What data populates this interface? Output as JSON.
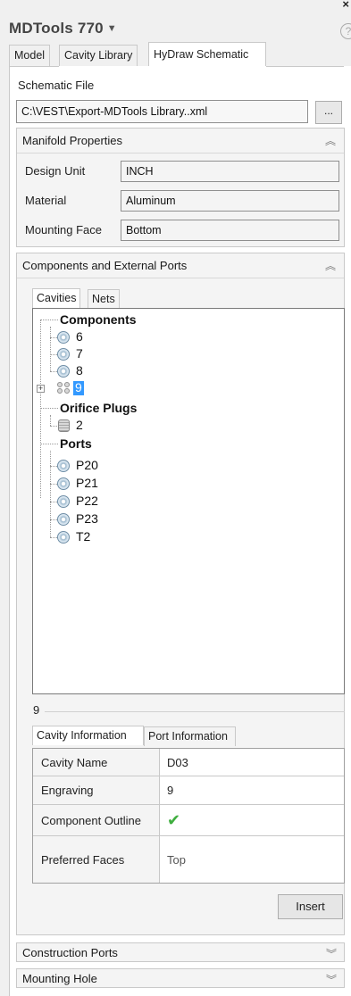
{
  "window": {
    "title": "MDTools 770",
    "close_glyph": "×",
    "help_glyph": "?"
  },
  "top_tabs": [
    {
      "label": "Model"
    },
    {
      "label": "Cavity Library"
    },
    {
      "label": "HyDraw Schematic",
      "active": true
    }
  ],
  "schematic": {
    "label": "Schematic File",
    "path": "C:\\VEST\\Export-MDTools Library..xml",
    "browse_label": "..."
  },
  "manifold": {
    "header": "Manifold Properties",
    "fields": [
      {
        "label": "Design Unit",
        "value": "INCH"
      },
      {
        "label": "Material",
        "value": "Aluminum"
      },
      {
        "label": "Mounting Face",
        "value": "Bottom"
      }
    ]
  },
  "components": {
    "header": "Components and External Ports",
    "tabs": [
      "Cavities",
      "Nets"
    ],
    "tree": {
      "components_label": "Components",
      "components": [
        "6",
        "7",
        "8"
      ],
      "selected_group": "9",
      "orifice_label": "Orifice Plugs",
      "orifice": [
        "2"
      ],
      "ports_label": "Ports",
      "ports": [
        "P20",
        "P21",
        "P22",
        "P23",
        "T2"
      ]
    }
  },
  "selection": {
    "group_label": "9",
    "tabs": [
      "Cavity Information",
      "Port Information"
    ],
    "rows": [
      {
        "key": "Cavity Name",
        "value": "D03"
      },
      {
        "key": "Engraving",
        "value": "9"
      },
      {
        "key": "Component Outline",
        "value": "✔",
        "icon": "check-icon"
      },
      {
        "key": "Preferred Faces",
        "value": "Top"
      }
    ],
    "insert_label": "Insert"
  },
  "collapsed_sections": [
    {
      "label": "Construction Ports"
    },
    {
      "label": "Mounting Hole"
    }
  ],
  "colors": {
    "selection": "#3399ff",
    "check": "#3fae3f"
  }
}
